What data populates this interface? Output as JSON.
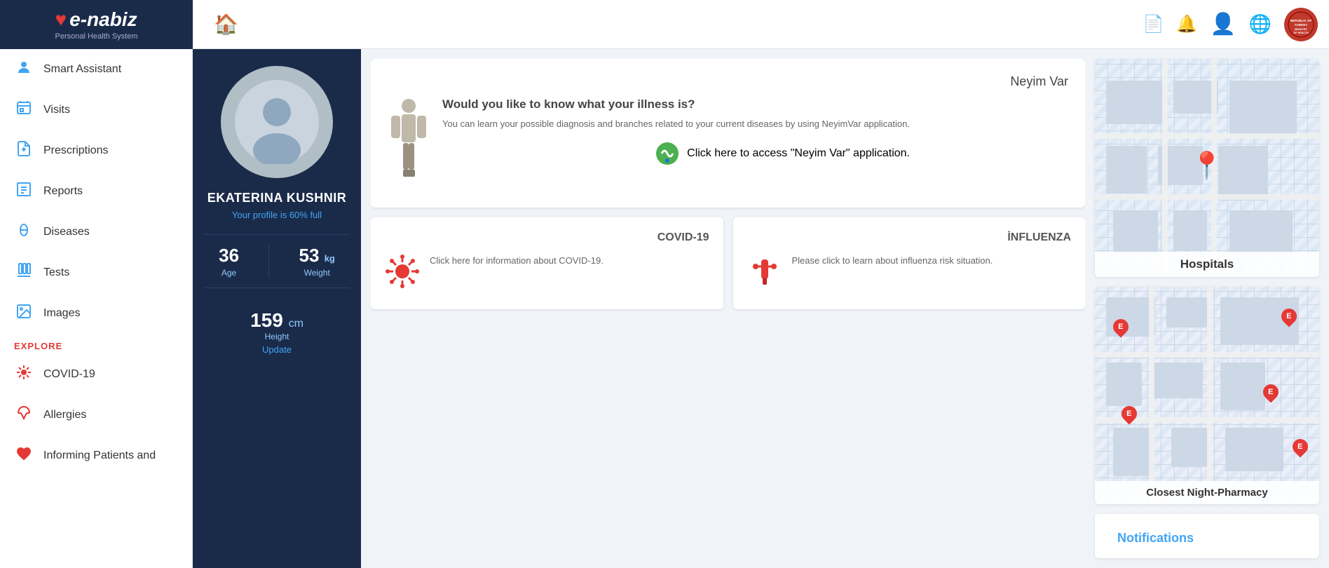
{
  "header": {
    "home_label": "🏠",
    "logo_brand": "e-nabiz",
    "logo_subtitle": "Personal Health System",
    "icons": {
      "document": "📄",
      "bell": "🔔",
      "user": "👤",
      "globe": "🌐"
    },
    "ministry_label": "REPUBLIC OF TURKEY MINISTRY OF HEALTH"
  },
  "sidebar": {
    "main_items": [
      {
        "id": "smart-assistant",
        "label": "Smart Assistant",
        "icon": "👤"
      },
      {
        "id": "visits",
        "label": "Visits",
        "icon": "🏥"
      },
      {
        "id": "prescriptions",
        "label": "Prescriptions",
        "icon": "📋"
      },
      {
        "id": "reports",
        "label": "Reports",
        "icon": "📊"
      },
      {
        "id": "diseases",
        "label": "Diseases",
        "icon": "🦷"
      },
      {
        "id": "tests",
        "label": "Tests",
        "icon": "🧪"
      },
      {
        "id": "images",
        "label": "Images",
        "icon": "🖼️"
      }
    ],
    "explore_label": "EXPLORE",
    "explore_items": [
      {
        "id": "covid19",
        "label": "COVID-19",
        "icon": "🦠"
      },
      {
        "id": "allergies",
        "label": "Allergies",
        "icon": "🤧"
      },
      {
        "id": "informing",
        "label": "Informing Patients and",
        "icon": "❤️"
      }
    ]
  },
  "profile": {
    "name": "EKATERINA KUSHNIR",
    "completion_text": "Your profile is 60% full",
    "age_value": "36",
    "age_label": "Age",
    "weight_value": "53",
    "weight_unit": "kg",
    "weight_label": "Weight",
    "height_value": "159",
    "height_unit": "cm",
    "height_label": "Height",
    "update_label": "Update"
  },
  "neyimvar": {
    "title": "Neyim Var",
    "heading": "Would you like to know what your illness is?",
    "description": "You can learn your possible diagnosis and branches related to your current diseases by using NeyimVar application.",
    "link_text": "Click here to access \"Neyim Var\" application."
  },
  "covid_card": {
    "title": "COVID-19",
    "text": "Click here for information about COVID-19."
  },
  "influenza_card": {
    "title": "İNFLUENZA",
    "text": "Please click to learn about influenza risk situation."
  },
  "right_panel": {
    "hospitals_label": "Hospitals",
    "pharmacy_label": "Closest Night-Pharmacy",
    "notifications_label": "Notifications"
  }
}
